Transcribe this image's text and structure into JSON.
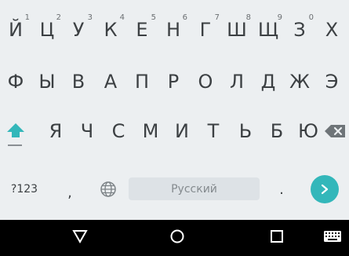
{
  "row1": [
    {
      "label": "Й",
      "hint": "1"
    },
    {
      "label": "Ц",
      "hint": "2"
    },
    {
      "label": "У",
      "hint": "3"
    },
    {
      "label": "К",
      "hint": "4"
    },
    {
      "label": "Е",
      "hint": "5"
    },
    {
      "label": "Н",
      "hint": "6"
    },
    {
      "label": "Г",
      "hint": "7"
    },
    {
      "label": "Ш",
      "hint": "8"
    },
    {
      "label": "Щ",
      "hint": "9"
    },
    {
      "label": "З",
      "hint": "0"
    },
    {
      "label": "Х",
      "hint": ""
    }
  ],
  "row2": [
    {
      "label": "Ф"
    },
    {
      "label": "Ы"
    },
    {
      "label": "В"
    },
    {
      "label": "А"
    },
    {
      "label": "П"
    },
    {
      "label": "Р"
    },
    {
      "label": "О"
    },
    {
      "label": "Л"
    },
    {
      "label": "Д"
    },
    {
      "label": "Ж"
    },
    {
      "label": "Э"
    }
  ],
  "row3": [
    {
      "label": "Я"
    },
    {
      "label": "Ч"
    },
    {
      "label": "С"
    },
    {
      "label": "М"
    },
    {
      "label": "И"
    },
    {
      "label": "Т"
    },
    {
      "label": "Ь"
    },
    {
      "label": "Б"
    },
    {
      "label": "Ю"
    }
  ],
  "bottom": {
    "symbols_label": "?123",
    "comma_label": ",",
    "space_label": "Русский",
    "period_label": "."
  },
  "colors": {
    "keyboard_bg": "#eceff1",
    "key_text": "#3c4043",
    "accent": "#33b7ba",
    "space_bg": "#dde2e6",
    "navbar_bg": "#000000"
  },
  "icons": {
    "shift": "shift-arrow-icon",
    "backspace": "backspace-icon",
    "globe": "globe-icon",
    "enter": "enter-arrow-icon",
    "back": "back-triangle-icon",
    "home": "home-circle-icon",
    "recents": "recents-square-icon",
    "keyboard_switch": "keyboard-icon"
  }
}
